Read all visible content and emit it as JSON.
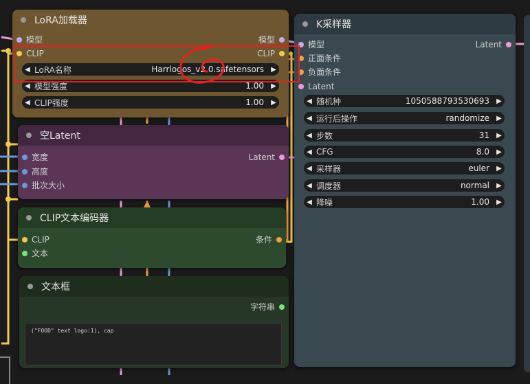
{
  "lora_loader": {
    "title": "LoRA加载器",
    "inputs": {
      "model": "模型",
      "clip": "CLIP"
    },
    "outputs": {
      "model": "模型",
      "clip": "CLIP"
    },
    "widgets": {
      "lora_name": {
        "label": "LoRA名称",
        "value": "Harrlogos_v2.0.safetensors"
      },
      "model_strength": {
        "label": "模型强度",
        "value": "1.00"
      },
      "clip_strength": {
        "label": "CLIP强度",
        "value": "1.00"
      }
    }
  },
  "empty_latent": {
    "title": "空Latent",
    "inputs": [
      "宽度",
      "高度",
      "批次大小"
    ],
    "output": "Latent"
  },
  "clip_encoder": {
    "title": "CLIP文本编码器",
    "inputs": {
      "clip": "CLIP",
      "text": "文本"
    },
    "output": "条件"
  },
  "text_box": {
    "title": "文本框",
    "output": "字符串",
    "text": "(\"FOOD\" text logo:1), cap"
  },
  "ksampler": {
    "title": "K采样器",
    "inputs": {
      "model": "模型",
      "positive": "正面条件",
      "negative": "负面条件",
      "latent": "Latent"
    },
    "output": "Latent",
    "widgets": {
      "seed": {
        "label": "随机种",
        "value": "1050588793530693"
      },
      "control": {
        "label": "运行后操作",
        "value": "randomize"
      },
      "steps": {
        "label": "步数",
        "value": "31"
      },
      "cfg": {
        "label": "CFG",
        "value": "8.0"
      },
      "sampler": {
        "label": "采样器",
        "value": "euler"
      },
      "scheduler": {
        "label": "调度器",
        "value": "normal"
      },
      "denoise": {
        "label": "降噪",
        "value": "1.00"
      }
    }
  },
  "colors": {
    "lora_node": "#6e5630",
    "latent_node": "#5a3556",
    "clip_node": "#2e4a2e",
    "text_node": "#273727",
    "ksampler_node": "#3a4850",
    "annotation": "#e62020",
    "wire_yellow": "#f2c94c",
    "wire_orange": "#f0a040",
    "wire_pink": "#ee9bd6",
    "wire_blue": "#6a9ad6"
  }
}
